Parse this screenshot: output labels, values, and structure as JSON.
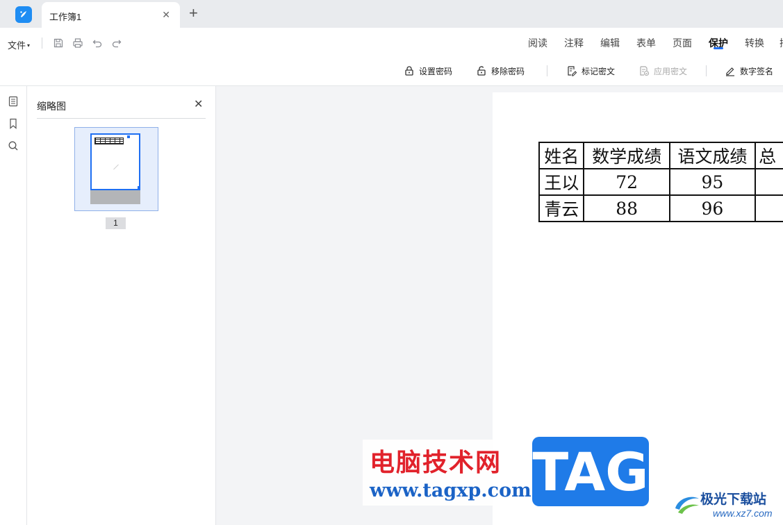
{
  "tabs": {
    "active_title": "工作簿1",
    "close_glyph": "✕",
    "add_glyph": "+"
  },
  "menu": {
    "file_label": "文件",
    "quick_actions": [
      "save-icon",
      "print-icon",
      "undo-icon",
      "redo-icon"
    ],
    "ribbon_tabs": [
      "阅读",
      "注释",
      "编辑",
      "表单",
      "页面",
      "保护",
      "转换",
      "插"
    ],
    "active_ribbon_tab": "保护"
  },
  "toolbar": {
    "set_password": "设置密码",
    "remove_password": "移除密码",
    "mark_redaction": "标记密文",
    "apply_redaction": "应用密文",
    "digital_signature": "数字签名"
  },
  "sidebar": {
    "rail_icons": [
      "thumbnail-icon",
      "bookmark-icon",
      "search-icon"
    ]
  },
  "thumbnail_panel": {
    "title": "缩略图",
    "close_glyph": "✕",
    "page_number": "1"
  },
  "document": {
    "table": {
      "header": [
        "姓名",
        "数学成绩",
        "语文成绩",
        "总"
      ],
      "rows": [
        [
          "王以",
          "72",
          "95",
          ""
        ],
        [
          "青云",
          "88",
          "96",
          ""
        ]
      ]
    }
  },
  "watermarks": {
    "site_name": "电脑技术网",
    "site_url": "www.tagxp.com",
    "tag_text": "TAG",
    "xz_name": "极光下载站",
    "xz_url": "www.xz7.com"
  },
  "colors": {
    "accent": "#1f6ff2",
    "tabbar_bg": "#e9ebee",
    "canvas_bg": "#f3f4f6"
  }
}
